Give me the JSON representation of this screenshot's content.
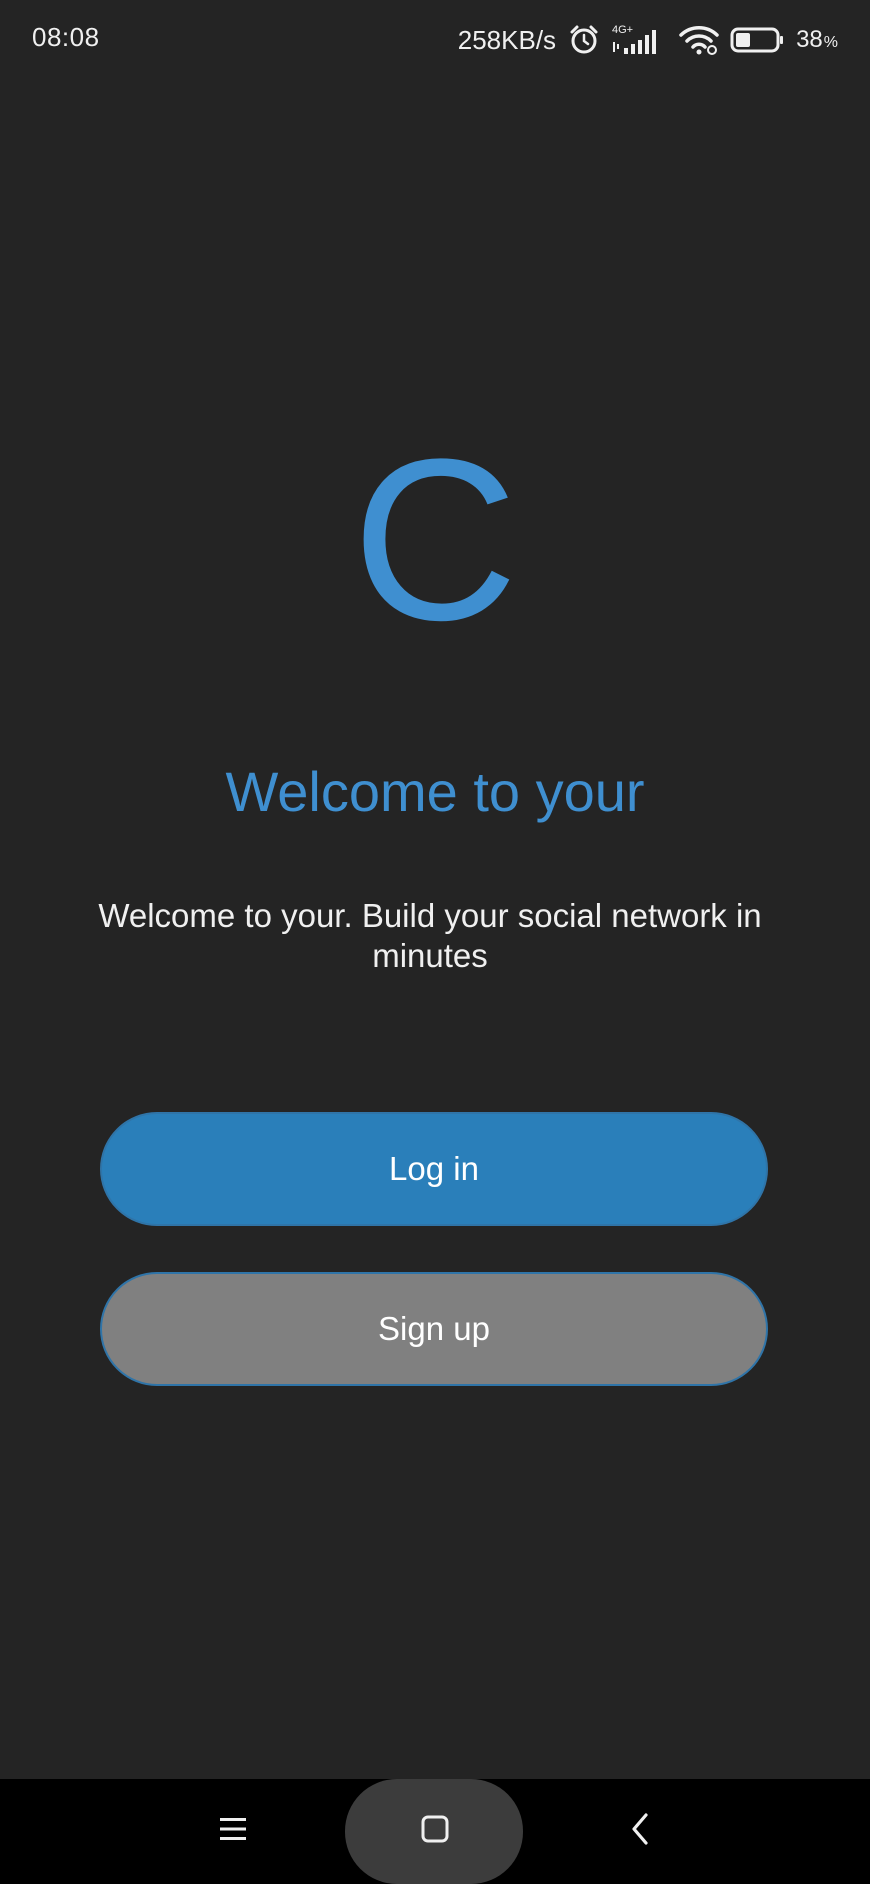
{
  "status_bar": {
    "time": "08:08",
    "net_speed": "258KB/s",
    "network_type": "4G+",
    "battery_percent": "38",
    "battery_percent_sign": "%",
    "battery_level": 0.38,
    "icons": [
      "alarm-icon",
      "signal-icon",
      "wifi-icon",
      "battery-icon"
    ]
  },
  "logo": {
    "letter": "C"
  },
  "welcome": {
    "title": "Welcome to your",
    "subtitle": "Welcome to your. Build your social network in minutes"
  },
  "buttons": {
    "login_label": "Log in",
    "signup_label": "Sign up"
  },
  "nav": {
    "icons": [
      "menu-icon",
      "home-icon",
      "back-icon"
    ]
  },
  "colors": {
    "background": "#242424",
    "accent": "#3f8fd0",
    "login_button": "#2a7fba",
    "signup_button": "#808080",
    "nav_bar": "#000000"
  }
}
